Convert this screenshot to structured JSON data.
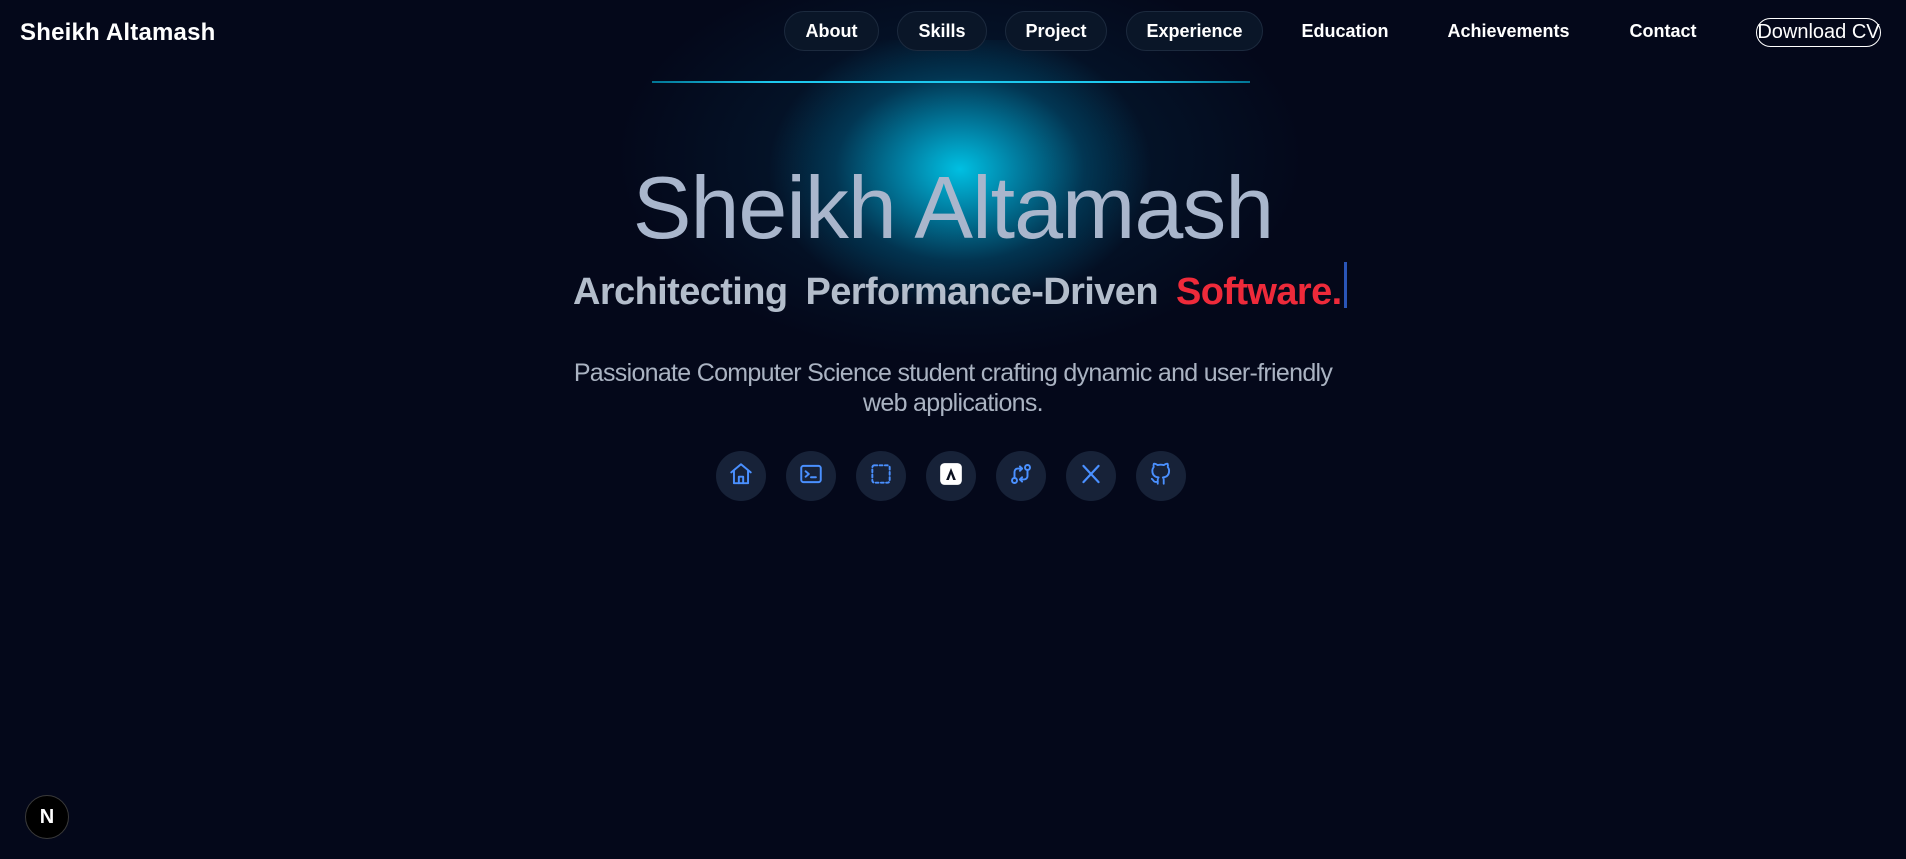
{
  "brand": "Sheikh Altamash",
  "nav": {
    "items": [
      {
        "label": "About"
      },
      {
        "label": "Skills"
      },
      {
        "label": "Project"
      },
      {
        "label": "Experience"
      },
      {
        "label": "Education"
      },
      {
        "label": "Achievements"
      },
      {
        "label": "Contact"
      }
    ],
    "download_label": "Download CV"
  },
  "hero": {
    "name": "Sheikh Altamash",
    "tagline": [
      "Architecting",
      "Performance-Driven",
      "Software."
    ],
    "description": "Passionate Computer Science student crafting dynamic and user-friendly web applications."
  },
  "social_icons": [
    "home-icon",
    "terminal-icon",
    "focus-icon",
    "app-logo-icon",
    "git-compare-icon",
    "x-icon",
    "github-icon"
  ],
  "badge": "N",
  "colors": {
    "background": "#04081a",
    "glow": "#00c8eb",
    "accent_red": "#ee2a3a",
    "icon_blue": "#4a90ff"
  }
}
